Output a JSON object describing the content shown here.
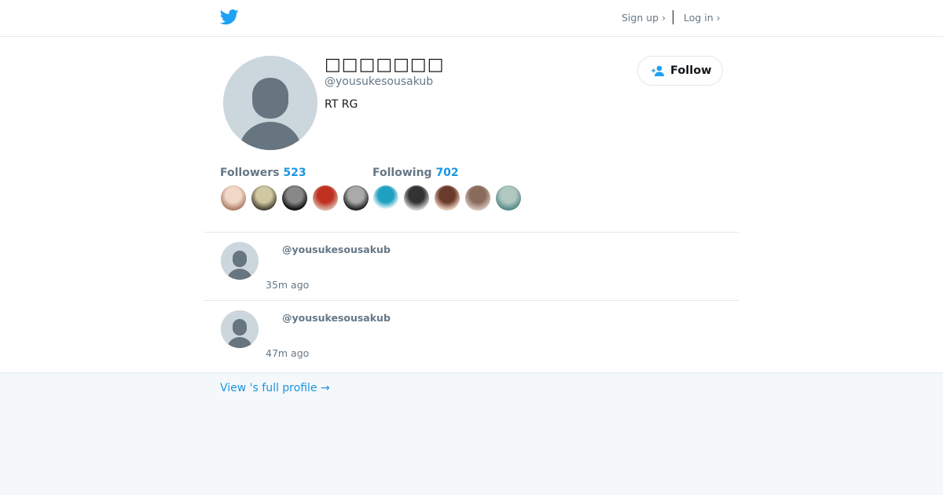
{
  "header": {
    "logo_icon": "twitter-bird-icon",
    "signup_label": "Sign up ›",
    "login_label": "Log in ›"
  },
  "profile": {
    "display_name": "□□□□□□□",
    "handle": "@yousukesousakub",
    "bio": "RT RG",
    "follow_label": "Follow",
    "follow_icon": "add-user-icon"
  },
  "stats": {
    "followers_label": "Followers",
    "followers_count": "523",
    "following_label": "Following",
    "following_count": "702"
  },
  "followers_avatars": [
    {
      "colors": [
        "#b0806a",
        "#f0d8c8"
      ]
    },
    {
      "colors": [
        "#4a4636",
        "#cfc8a0"
      ]
    },
    {
      "colors": [
        "#111111",
        "#888888"
      ]
    },
    {
      "colors": [
        "#d8b0a0",
        "#c03020"
      ]
    },
    {
      "colors": [
        "#222222",
        "#aaaaaa"
      ]
    }
  ],
  "following_avatars": [
    {
      "colors": [
        "#ffffff",
        "#20a0c0"
      ]
    },
    {
      "colors": [
        "#cccccc",
        "#333333"
      ]
    },
    {
      "colors": [
        "#e8c8b8",
        "#6a3a2a"
      ]
    },
    {
      "colors": [
        "#d0c0b8",
        "#8a6a5a"
      ]
    },
    {
      "colors": [
        "#5a8a8a",
        "#b0c8c0"
      ]
    }
  ],
  "tweets": [
    {
      "handle": "@yousukesousakub",
      "time": "35m ago"
    },
    {
      "handle": "@yousukesousakub",
      "time": "47m ago"
    }
  ],
  "footer": {
    "full_profile_label": "View 's full profile →"
  },
  "colors": {
    "accent": "#1b95e0",
    "twitter_blue": "#1da1f2",
    "muted": "#657786",
    "avatar_bg": "#ccd6dd",
    "avatar_fg": "#66757f"
  }
}
